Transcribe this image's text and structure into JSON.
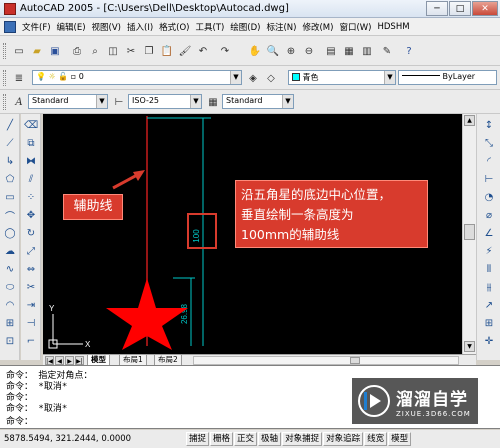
{
  "window": {
    "title": "AutoCAD 2005 - [C:\\Users\\Dell\\Desktop\\Autocad.dwg]"
  },
  "menu": {
    "items": [
      {
        "label": "文件(F)"
      },
      {
        "label": "编辑(E)"
      },
      {
        "label": "视图(V)"
      },
      {
        "label": "插入(I)"
      },
      {
        "label": "格式(O)"
      },
      {
        "label": "工具(T)"
      },
      {
        "label": "绘图(D)"
      },
      {
        "label": "标注(N)"
      },
      {
        "label": "修改(M)"
      },
      {
        "label": "窗口(W)"
      },
      {
        "label": "HDSHM"
      }
    ]
  },
  "layer_toolbar": {
    "layer_value": "0",
    "color_value": "青色",
    "linetype_value": "ByLayer",
    "color_swatch": "#00ffff"
  },
  "styles_toolbar": {
    "text_style": "Standard",
    "dim_style": "ISO-25",
    "table_style": "Standard"
  },
  "canvas": {
    "background": "#000000",
    "star_color": "#ff0000",
    "guide_line_color": "#c81c1c",
    "dimension_color": "#00c8c8",
    "dim_100": "100",
    "dim_2698": "26.98",
    "axis_y": "Y",
    "axis_x": "X",
    "callout_label": "辅助线",
    "callout_bg": "#d83b2d",
    "callout_lines": [
      "沿五角星的底边中心位置，",
      "垂直绘制一条高度为",
      "100mm的辅助线"
    ]
  },
  "layout_tabs": [
    "模型",
    "布局1",
    "布局2"
  ],
  "command": {
    "lines": [
      "命令： 指定对角点：",
      "命令： *取消*",
      "命令：",
      "命令： *取消*",
      "命令："
    ]
  },
  "status": {
    "coords": "5878.5494, 321.2444, 0.0000",
    "buttons": [
      "捕捉",
      "栅格",
      "正交",
      "极轴",
      "对象捕捉",
      "对象追踪",
      "线宽",
      "模型"
    ]
  },
  "watermark": {
    "cn": "溜溜自学",
    "en": "ZIXUE.3D66.COM",
    "accent": "#1f7fd1"
  }
}
